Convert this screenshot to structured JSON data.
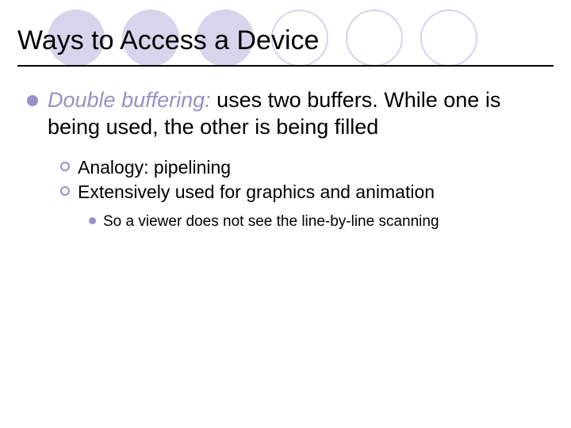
{
  "title": "Ways to Access a Device",
  "bullet1": {
    "emphasis": "Double buffering:",
    "rest": "  uses two buffers. While one is being used, the other is being filled"
  },
  "sub": {
    "a": "Analogy:  pipelining",
    "b": "Extensively used for graphics and animation"
  },
  "subsub": {
    "a": "So a viewer does not see the line-by-line scanning"
  }
}
